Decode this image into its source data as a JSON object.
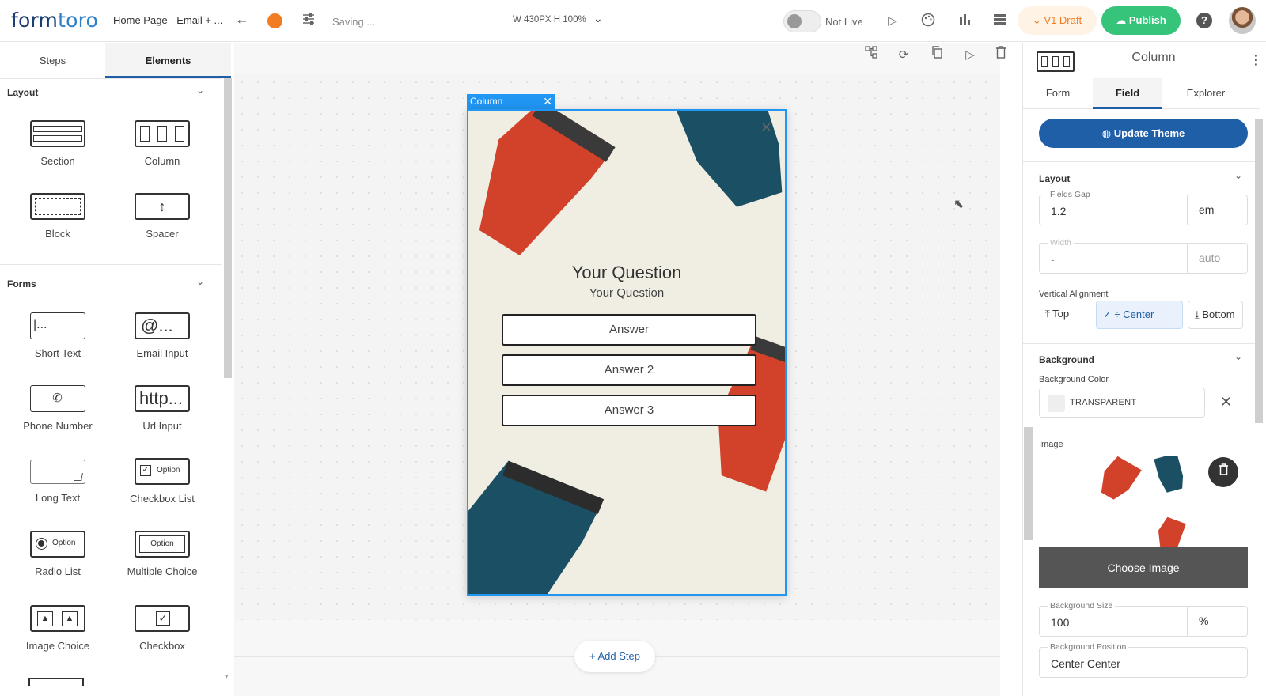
{
  "header": {
    "logo_prefix": "form",
    "logo_suffix": "toro",
    "breadcrumb": "Home Page - Email + ...",
    "back_icon": "arrow-left-icon",
    "status_text": "Saving ...",
    "dimensions": "W 430PX  H 100%",
    "toggle_label": "Not Live",
    "draft_label": "V1 Draft",
    "publish_label": "Publish",
    "help_label": "?",
    "accent": "#f27c22",
    "publish_color": "#35c47a"
  },
  "left_panel": {
    "tabs": [
      "Steps",
      "Elements"
    ],
    "layout_section": "Layout",
    "forms_section": "Forms",
    "layout_items": [
      "Section",
      "Column",
      "Block",
      "Spacer"
    ],
    "form_items": [
      "Short Text",
      "Email Input",
      "Phone Number",
      "Url Input",
      "Long Text",
      "Checkbox List",
      "Radio List",
      "Multiple Choice",
      "Image Choice",
      "Checkbox"
    ],
    "icon_text": {
      "short_text": "|...",
      "email": "@...",
      "url": "http...",
      "option": "Option"
    }
  },
  "canvas": {
    "column_badge": "Column",
    "popup_close": "×",
    "question_title": "Your Question",
    "question_subtitle": "Your Question",
    "answers": [
      "Answer",
      "Answer 2",
      "Answer 3"
    ],
    "add_step": "Add Step"
  },
  "right_panel": {
    "title": "Column",
    "tabs": [
      "Form",
      "Field",
      "Explorer"
    ],
    "update_theme": "Update Theme",
    "layout_section": "Layout",
    "fields_gap_label": "Fields Gap",
    "fields_gap_value": "1.2",
    "fields_gap_unit": "em",
    "width_label": "Width",
    "width_value": "-",
    "width_unit": "auto",
    "valign_label": "Vertical Alignment",
    "valign_options": [
      "Top",
      "Center",
      "Bottom"
    ],
    "background_section": "Background",
    "bg_color_label": "Background Color",
    "bg_color_value": "TRANSPARENT",
    "image_label": "Image",
    "choose_image": "Choose Image",
    "bg_size_label": "Background Size",
    "bg_size_value": "100",
    "bg_size_unit": "%",
    "bg_position_label": "Background Position",
    "bg_position_value": "Center Center",
    "primary": "#1f5fa8"
  }
}
